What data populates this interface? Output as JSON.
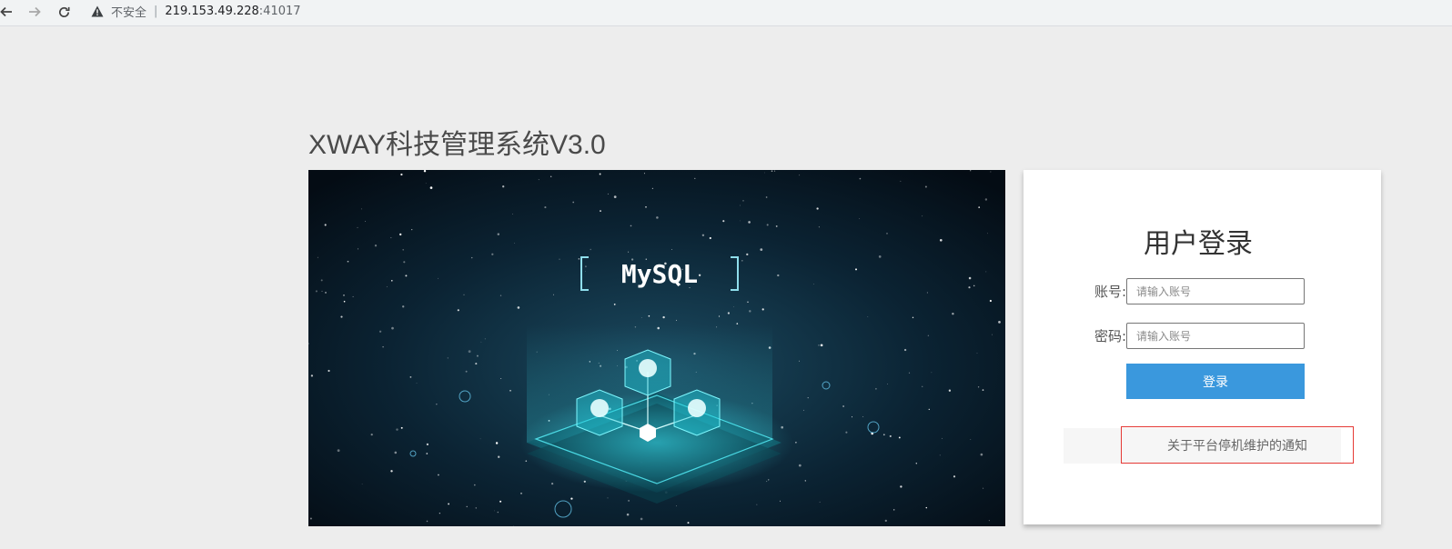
{
  "browser": {
    "back_icon": "arrow-left-icon",
    "forward_icon": "arrow-right-icon",
    "reload_icon": "reload-icon",
    "security_icon": "warning-triangle-icon",
    "security_label": "不安全",
    "url_host": "219.153.49.228",
    "url_port": ":41017"
  },
  "page": {
    "title": "XWAY科技管理系统V3.0"
  },
  "banner": {
    "label": "MySQL"
  },
  "login": {
    "title": "用户登录",
    "account_label": "账号:",
    "account_placeholder": "请输入账号",
    "password_label": "密码:",
    "password_placeholder": "请输入账号",
    "submit_label": "登录",
    "notice_label": "关于平台停机维护的通知"
  },
  "colors": {
    "background": "#ededed",
    "accent": "#3a98dd",
    "notice_border": "#e53935"
  }
}
